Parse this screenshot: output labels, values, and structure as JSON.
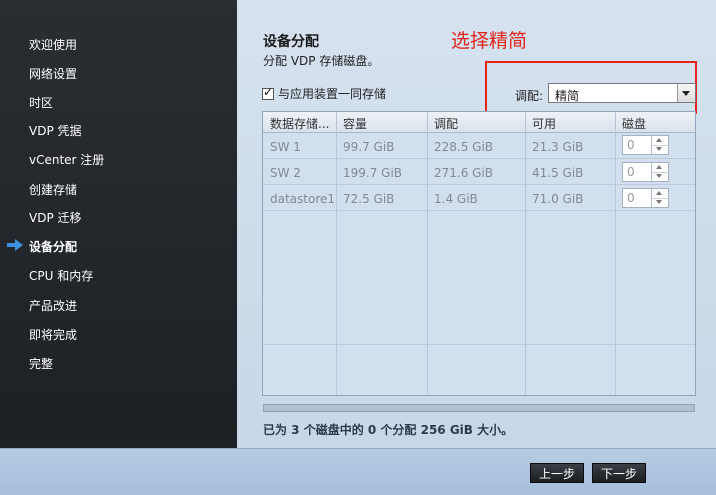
{
  "sidebar": {
    "items": [
      {
        "label": "欢迎使用"
      },
      {
        "label": "网络设置"
      },
      {
        "label": "时区"
      },
      {
        "label": "VDP 凭据"
      },
      {
        "label": "vCenter 注册"
      },
      {
        "label": "创建存储"
      },
      {
        "label": "VDP 迁移"
      },
      {
        "label": "设备分配",
        "active": true
      },
      {
        "label": "CPU 和内存"
      },
      {
        "label": "产品改进"
      },
      {
        "label": "即将完成"
      },
      {
        "label": "完整"
      }
    ]
  },
  "main": {
    "title": "设备分配",
    "subtitle": "分配 VDP 存储磁盘。",
    "annotation": "选择精简",
    "colocate_label": "与应用装置一同存储",
    "colocate_checked": true,
    "provision_label": "调配:",
    "provision_value": "精简"
  },
  "table": {
    "headers": [
      "数据存储...",
      "容量",
      "调配",
      "可用",
      "磁盘"
    ],
    "rows": [
      {
        "datastore": "SW 1",
        "capacity": "99.7 GiB",
        "provisioned": "228.5 GiB",
        "available": "21.3 GiB",
        "disks": "0"
      },
      {
        "datastore": "SW 2",
        "capacity": "199.7 GiB",
        "provisioned": "271.6 GiB",
        "available": "41.5 GiB",
        "disks": "0"
      },
      {
        "datastore": "datastore1",
        "capacity": "72.5 GiB",
        "provisioned": "1.4 GiB",
        "available": "71.0 GiB",
        "disks": "0"
      }
    ]
  },
  "summary": "已为 3 个磁盘中的 0 个分配 256 GiB 大小。",
  "footer": {
    "back_label": "上一步",
    "next_label": "下一步"
  },
  "colors": {
    "annotation": "#e3241b",
    "sidebar_bg": "#2a2d31",
    "panel_bg": "#d6e2ef"
  }
}
